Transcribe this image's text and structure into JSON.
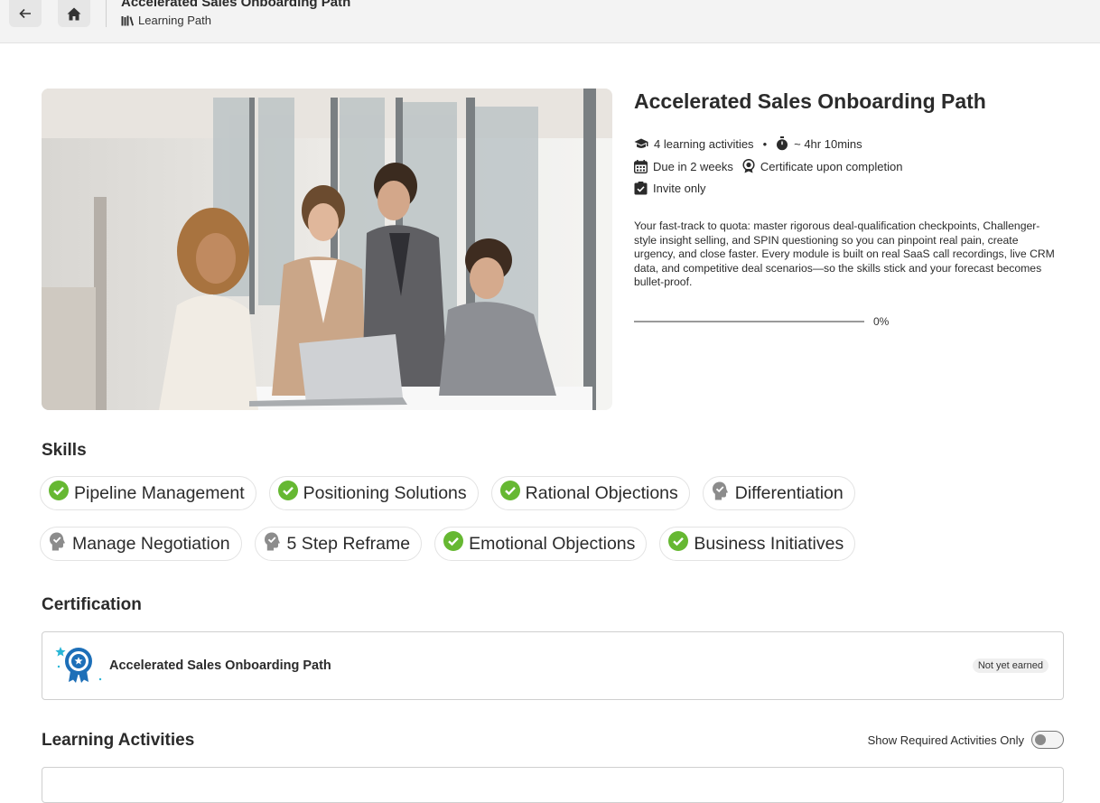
{
  "topbar": {
    "title": "Accelerated Sales Onboarding Path",
    "subtitle": "Learning Path"
  },
  "course": {
    "title": "Accelerated Sales Onboarding Path",
    "activities": "4 learning activities",
    "duration": "~ 4hr 10mins",
    "due": "Due in 2 weeks",
    "certificate": "Certificate upon completion",
    "access": "Invite only",
    "description": "Your fast-track to quota: master rigorous deal-qualification checkpoints, Challenger-style insight selling, and SPIN questioning so you can pinpoint real pain, create urgency, and close faster. Every module is built on real SaaS call recordings, live CRM data, and competitive deal scenarios—so the skills stick and your forecast becomes bullet-proof.",
    "progress_percent": 0,
    "progress_label": "0%"
  },
  "skills": {
    "heading": "Skills",
    "items": [
      {
        "label": "Pipeline Management",
        "earned": true
      },
      {
        "label": "Positioning Solutions",
        "earned": true
      },
      {
        "label": "Rational Objections",
        "earned": true
      },
      {
        "label": "Differentiation",
        "earned": false
      },
      {
        "label": "Manage Negotiation",
        "earned": false
      },
      {
        "label": "5 Step Reframe",
        "earned": false
      },
      {
        "label": "Emotional Objections",
        "earned": true
      },
      {
        "label": "Business Initiatives",
        "earned": true
      }
    ]
  },
  "certification": {
    "heading": "Certification",
    "title": "Accelerated Sales Onboarding Path",
    "status": "Not yet earned"
  },
  "activities": {
    "heading": "Learning Activities",
    "toggle_label": "Show Required Activities Only",
    "toggle_on": false
  },
  "colors": {
    "check_green": "#66b832",
    "pending_gray": "#8c8c8c",
    "cert_blue": "#1d6fb8",
    "accent_teal": "#29b6d6"
  }
}
